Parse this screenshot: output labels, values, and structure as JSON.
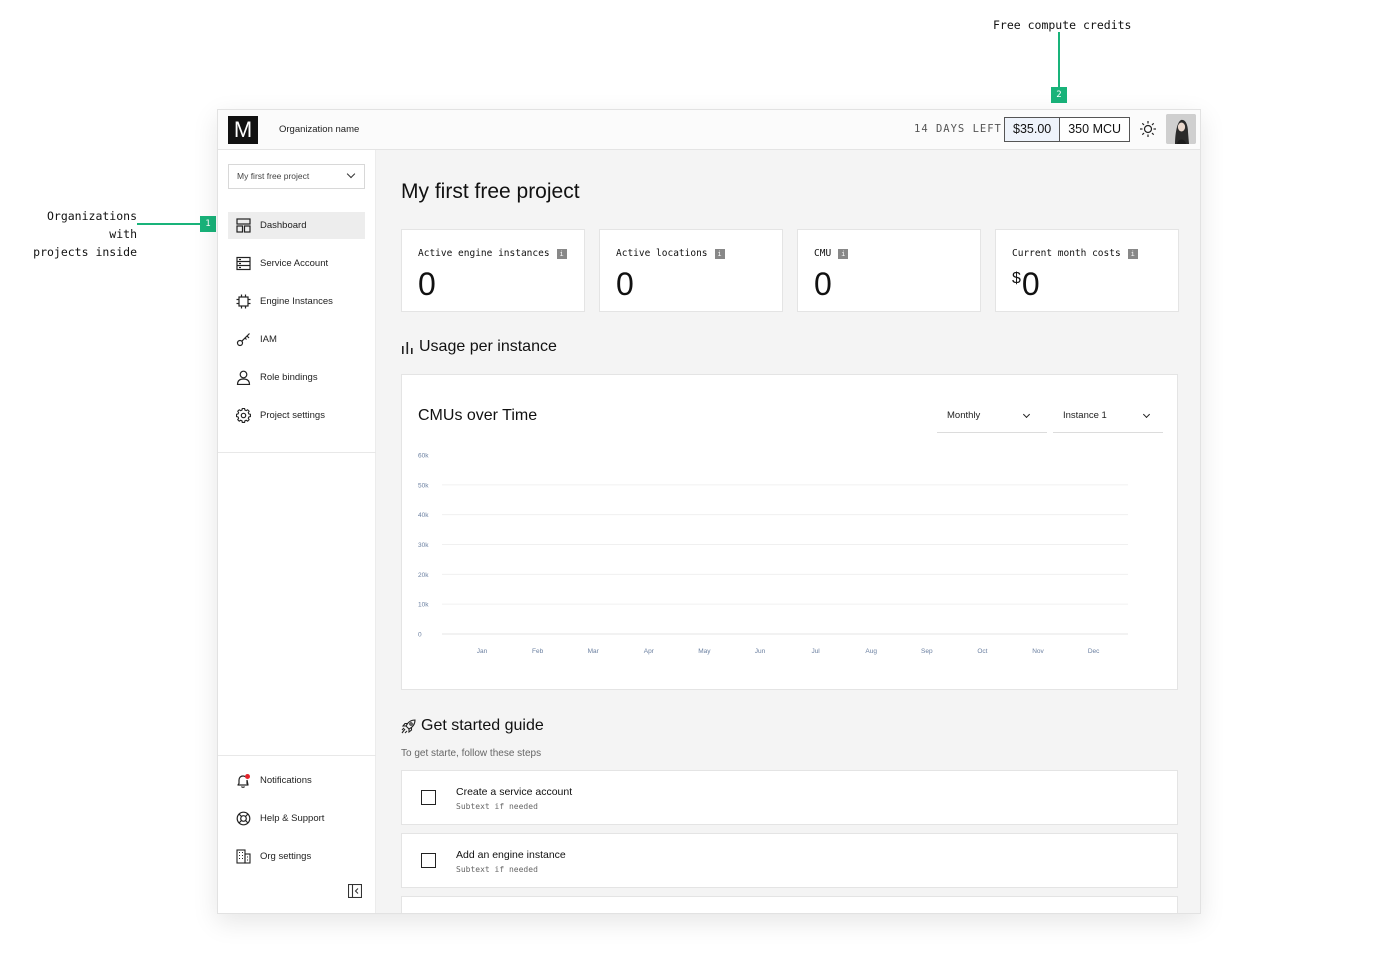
{
  "annotations": {
    "left_note_line1": "Organizations with",
    "left_note_line2": "projects inside",
    "left_badge": "1",
    "top_note": "Free compute credits",
    "top_badge": "2"
  },
  "header": {
    "logo": "M",
    "org_name": "Organization name",
    "days_left": "14 DAYS LEFT",
    "credit_amount": "$35.00",
    "credit_mcu": "350 MCU"
  },
  "sidebar": {
    "project_select": "My first free project",
    "items": [
      {
        "label": "Dashboard",
        "icon": "dashboard-icon"
      },
      {
        "label": "Service Account",
        "icon": "service-account-icon"
      },
      {
        "label": "Engine Instances",
        "icon": "chip-icon"
      },
      {
        "label": "IAM",
        "icon": "key-icon"
      },
      {
        "label": "Role bindings",
        "icon": "user-icon"
      },
      {
        "label": "Project settings",
        "icon": "gear-icon"
      }
    ],
    "bottom_items": [
      {
        "label": "Notifications",
        "icon": "bell-icon"
      },
      {
        "label": "Help & Support",
        "icon": "lifebuoy-icon"
      },
      {
        "label": "Org settings",
        "icon": "building-icon"
      }
    ]
  },
  "main": {
    "title": "My first free project",
    "stats": [
      {
        "label": "Active engine instances",
        "value": "0"
      },
      {
        "label": "Active locations",
        "value": "0"
      },
      {
        "label": "CMU",
        "value": "0"
      },
      {
        "label": "Current month costs",
        "currency": "$",
        "value": "0"
      }
    ],
    "usage_title": "Usage per instance",
    "chart": {
      "title": "CMUs over Time",
      "period_select": "Monthly",
      "instance_select": "Instance 1"
    },
    "guide_title": "Get started guide",
    "guide_subtitle": "To get starte, follow these steps",
    "tasks": [
      {
        "title": "Create a service account",
        "subtext": "Subtext if needed"
      },
      {
        "title": "Add an engine instance",
        "subtext": "Subtext if needed"
      }
    ]
  },
  "chart_data": {
    "type": "line",
    "title": "CMUs over Time",
    "categories": [
      "Jan",
      "Feb",
      "Mar",
      "Apr",
      "May",
      "Jun",
      "Jul",
      "Aug",
      "Sep",
      "Oct",
      "Nov",
      "Dec"
    ],
    "y_ticks": [
      "0",
      "10k",
      "20k",
      "30k",
      "40k",
      "50k",
      "60k"
    ],
    "ylim": [
      0,
      60000
    ],
    "series": [],
    "grid": true
  }
}
